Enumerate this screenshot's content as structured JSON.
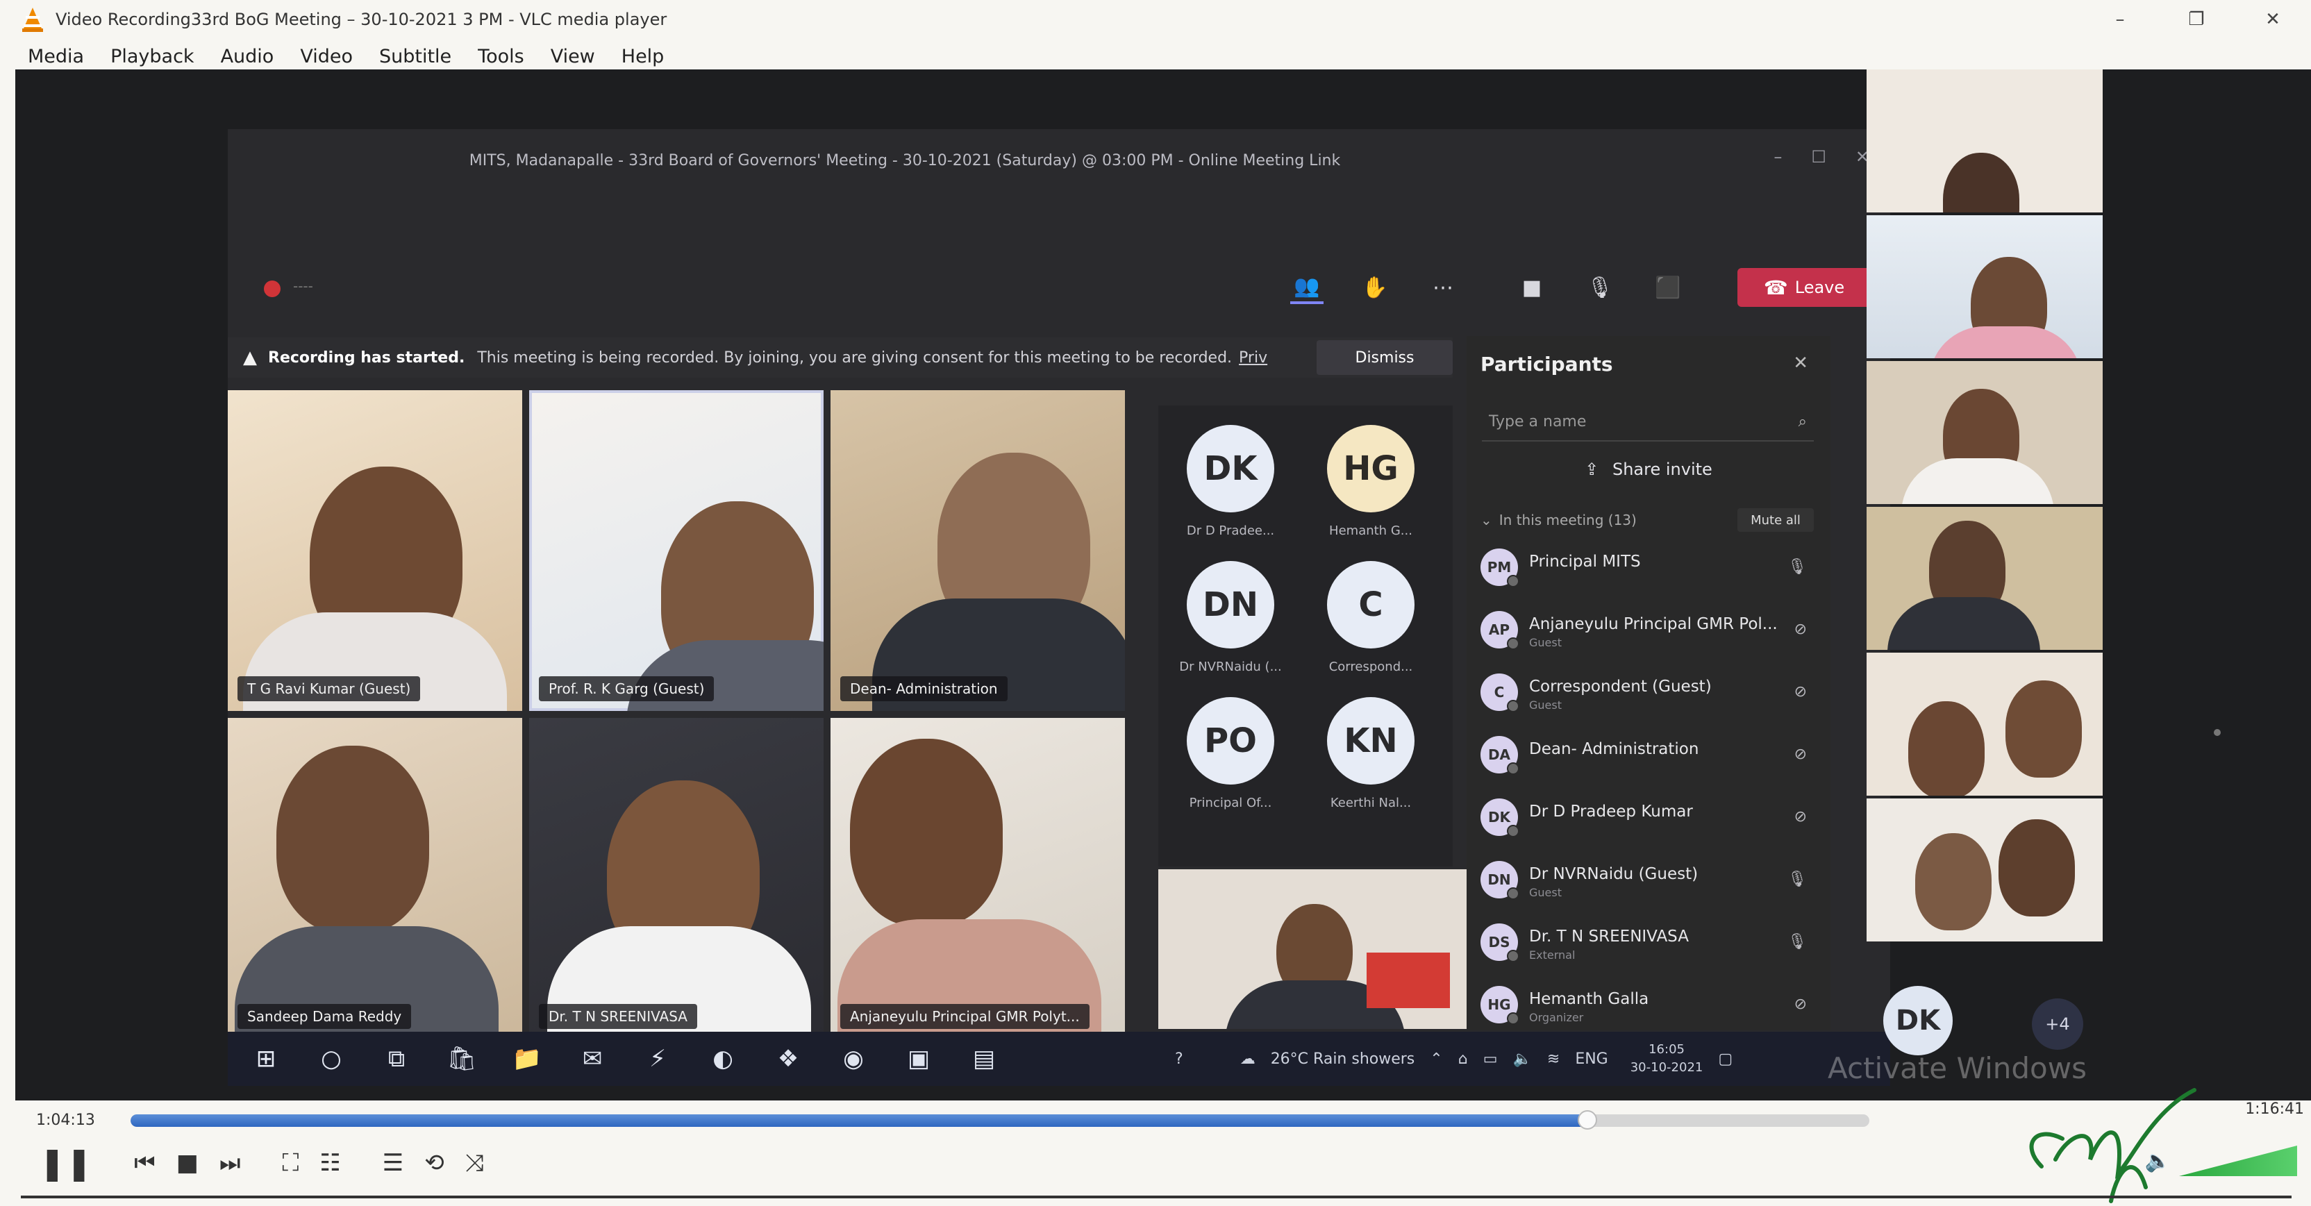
{
  "window": {
    "title": "Video Recording33rd BoG Meeting – 30-10-2021 3 PM - VLC media player",
    "controls": [
      "–",
      "❐",
      "✕"
    ]
  },
  "menu": [
    "Media",
    "Playback",
    "Audio",
    "Video",
    "Subtitle",
    "Tools",
    "View",
    "Help"
  ],
  "teams": {
    "title": "MITS, Madanapalle - 33rd Board of Governors' Meeting - 30-10-2021 (Saturday) @ 03:00 PM - Online Meeting Link",
    "rec_time": "----",
    "leave_label": "Leave",
    "banner": {
      "bold": "Recording has started.",
      "text": "This meeting is being recorded. By joining, you are giving consent for this meeting to be recorded.",
      "link": "Priv",
      "dismiss": "Dismiss"
    },
    "video_tiles": [
      "T G Ravi Kumar (Guest)",
      "Prof. R. K Garg (Guest)",
      "Dean- Administration",
      "Sandeep Dama Reddy",
      "Dr. T N SREENIVASA",
      "Anjaneyulu Principal GMR Polyt..."
    ],
    "avatar_tiles": [
      {
        "initials": "DK",
        "name": "Dr D Pradee..."
      },
      {
        "initials": "HG",
        "name": "Hemanth G..."
      },
      {
        "initials": "DN",
        "name": "Dr NVRNaidu (..."
      },
      {
        "initials": "C",
        "name": "Correspond..."
      },
      {
        "initials": "PO",
        "name": "Principal Of..."
      },
      {
        "initials": "KN",
        "name": "Keerthi Nal..."
      }
    ],
    "participants": {
      "title": "Participants",
      "search_placeholder": "Type a name",
      "share_invite": "Share invite",
      "section": "In this meeting (13)",
      "mute_all": "Mute all",
      "list": [
        {
          "initials": "PM",
          "name": "Principal MITS",
          "role": "",
          "muted": false
        },
        {
          "initials": "AP",
          "name": "Anjaneyulu Principal GMR Pol...",
          "role": "Guest",
          "muted": true
        },
        {
          "initials": "C",
          "name": "Correspondent (Guest)",
          "role": "Guest",
          "muted": true
        },
        {
          "initials": "DA",
          "name": "Dean- Administration",
          "role": "",
          "muted": true
        },
        {
          "initials": "DK",
          "name": "Dr D Pradeep Kumar",
          "role": "",
          "muted": true
        },
        {
          "initials": "DN",
          "name": "Dr NVRNaidu (Guest)",
          "role": "Guest",
          "muted": false
        },
        {
          "initials": "DS",
          "name": "Dr. T N SREENIVASA",
          "role": "External",
          "muted": false
        },
        {
          "initials": "HG",
          "name": "Hemanth Galla",
          "role": "Organizer",
          "muted": true
        }
      ]
    },
    "taskbar": {
      "weather": "26°C Rain showers",
      "lang": "ENG",
      "time": "16:05",
      "date": "30-10-2021"
    }
  },
  "strip": {
    "avatar": "DK",
    "more": "+4",
    "watermark": "Activate Windows"
  },
  "player": {
    "current_time": "1:04:13",
    "total_time": "1:16:41",
    "progress": 0.838,
    "volume": "100%"
  }
}
